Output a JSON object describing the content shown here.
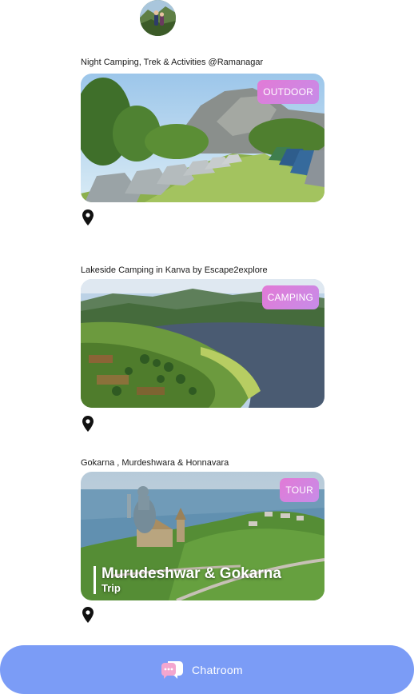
{
  "profile": {
    "avatar": "user-avatar-photo"
  },
  "cards": [
    {
      "title": "Night Camping, Trek & Activities @Ramanagar",
      "tag": "OUTDOOR",
      "icon": "location-pin-icon"
    },
    {
      "title": "Lakeside Camping in Kanva by Escape2explore",
      "tag": "CAMPING",
      "icon": "location-pin-icon"
    },
    {
      "title": "Gokarna , Murdeshwara & Honnavara",
      "tag": "TOUR",
      "overlay_title": "Murudeshwar & Gokarna",
      "overlay_subtitle": "Trip",
      "icon": "location-pin-icon"
    }
  ],
  "chat": {
    "label": "Chatroom",
    "icon": "chat-bubble-icon"
  },
  "colors": {
    "tag_gradient_start": "#e27ad6",
    "tag_gradient_end": "#c78ce8",
    "chat_bar": "#7b9cf6"
  }
}
